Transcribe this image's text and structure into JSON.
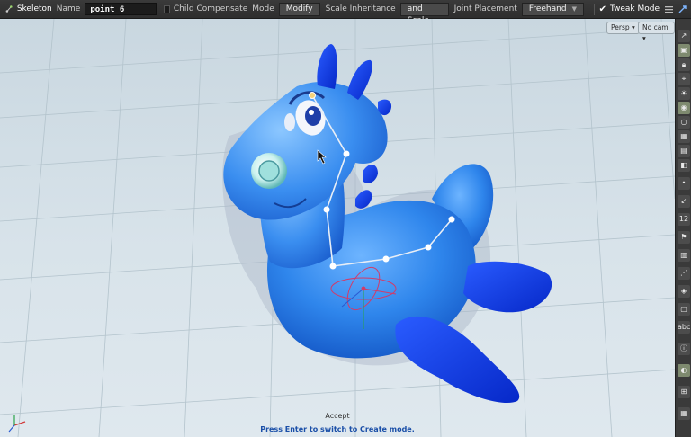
{
  "toolbar": {
    "tool_icon": "skeleton-bone-icon",
    "tool_name": "Skeleton",
    "name_label": "Name",
    "name_value": "point_6",
    "child_compensate_label": "Child Compensate",
    "mode_label": "Mode",
    "mode_value": "Modify",
    "scale_inheritance_label": "Scale Inheritance",
    "scale_inheritance_value": "Offset and Scale",
    "joint_placement_label": "Joint Placement",
    "joint_placement_value": "Freehand",
    "tweak_mode_label": "Tweak Mode"
  },
  "viewport": {
    "persp_label": "Persp",
    "cam_label": "No cam",
    "accept_label": "Accept",
    "hint": "Press Enter to switch to Create mode."
  },
  "shelf": {
    "icons": [
      "arrow-icon",
      "view-icon",
      "lock-icon",
      "snap-icon",
      "light-icon",
      "bulb-icon",
      "grid-icon",
      "wire-icon",
      "shade-icon",
      "dot-icon",
      "curve-icon",
      "number-icon",
      "flag-icon",
      "display-icon",
      "point-icon",
      "box-icon",
      "abc-icon",
      "mesh-icon",
      "info-icon",
      "bulb-icon-2",
      "grid-icon-2"
    ],
    "number_label": "12",
    "abc_label": "abc"
  },
  "colors": {
    "toolbar_bg": "#333333",
    "viewport_bg": "#d4dfe6",
    "model_blue": "#1f74e6",
    "hint_blue": "#1a4fa8",
    "joint": "#ffffff"
  }
}
